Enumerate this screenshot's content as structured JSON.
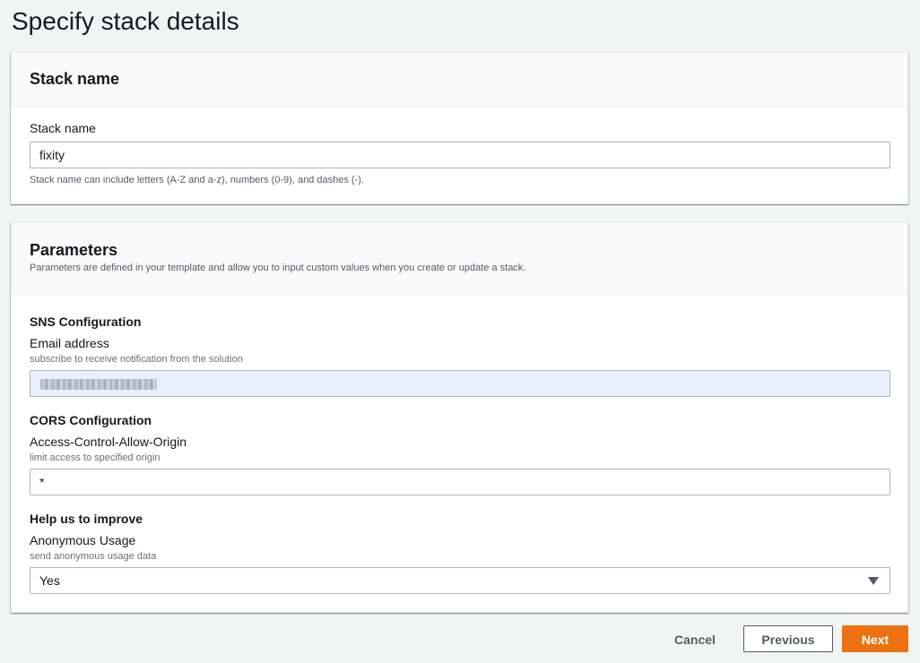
{
  "page": {
    "title": "Specify stack details"
  },
  "stack_name_panel": {
    "title": "Stack name",
    "label": "Stack name",
    "value": "fixity",
    "hint": "Stack name can include letters (A-Z and a-z), numbers (0-9), and dashes (-)."
  },
  "parameters_panel": {
    "title": "Parameters",
    "description": "Parameters are defined in your template and allow you to input custom values when you create or update a stack.",
    "sns": {
      "heading": "SNS Configuration",
      "label": "Email address",
      "hint": "subscribe to receive notification from the solution"
    },
    "cors": {
      "heading": "CORS Configuration",
      "label": "Access-Control-Allow-Origin",
      "hint": "limit access to specified origin",
      "value": "*"
    },
    "improve": {
      "heading": "Help us to improve",
      "label": "Anonymous Usage",
      "hint": "send anonymous usage data",
      "selected": "Yes"
    }
  },
  "footer": {
    "cancel_label": "Cancel",
    "previous_label": "Previous",
    "next_label": "Next"
  },
  "icons": {
    "dropdown": "caret-down-icon"
  },
  "colors": {
    "primary_button": "#ec7211",
    "autofill_background": "#e8f0fe",
    "page_background": "#f2f3f3"
  }
}
